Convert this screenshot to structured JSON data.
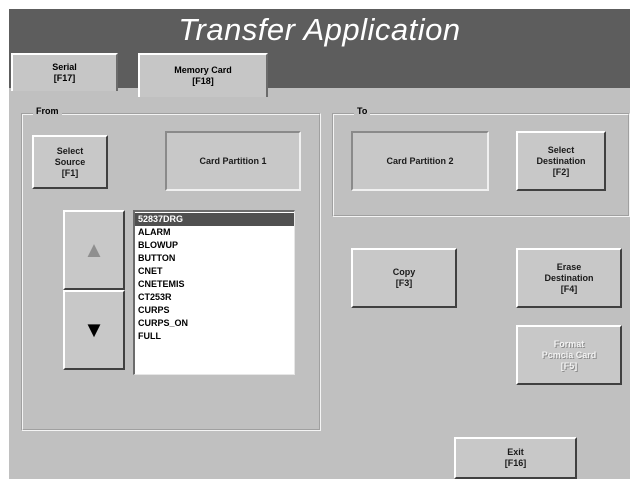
{
  "window": {
    "title": "Transfer Application"
  },
  "tabs": [
    {
      "label": "Serial\n[F17]"
    },
    {
      "label": "Memory Card\n[F18]"
    }
  ],
  "from_group": {
    "label": "From",
    "select_source_label": "Select\nSource\n[F1]",
    "partition_label": "Card Partition 1",
    "up_arrow": "▲",
    "down_arrow": "▼",
    "files": [
      "52837DRG",
      "ALARM",
      "BLOWUP",
      "BUTTON",
      "CNET",
      "CNETEMIS",
      "CT253R",
      "CURPS",
      "CURPS_ON",
      "FULL"
    ],
    "selected_file": "52837DRG"
  },
  "to_group": {
    "label": "To",
    "partition_label": "Card Partition 2",
    "select_destination_label": "Select\nDestination\n[F2]"
  },
  "actions": {
    "copy_label": "Copy\n[F3]",
    "erase_label": "Erase\nDestination\n[F4]",
    "format_label": "Format\nPcmcia Card\n[F5]",
    "exit_label": "Exit\n[F16]"
  },
  "colors": {
    "title_bar": "#5d5d5d",
    "panel": "#c0c0c0",
    "selection": "#505050",
    "disabled_text": "#f2f2f2"
  }
}
